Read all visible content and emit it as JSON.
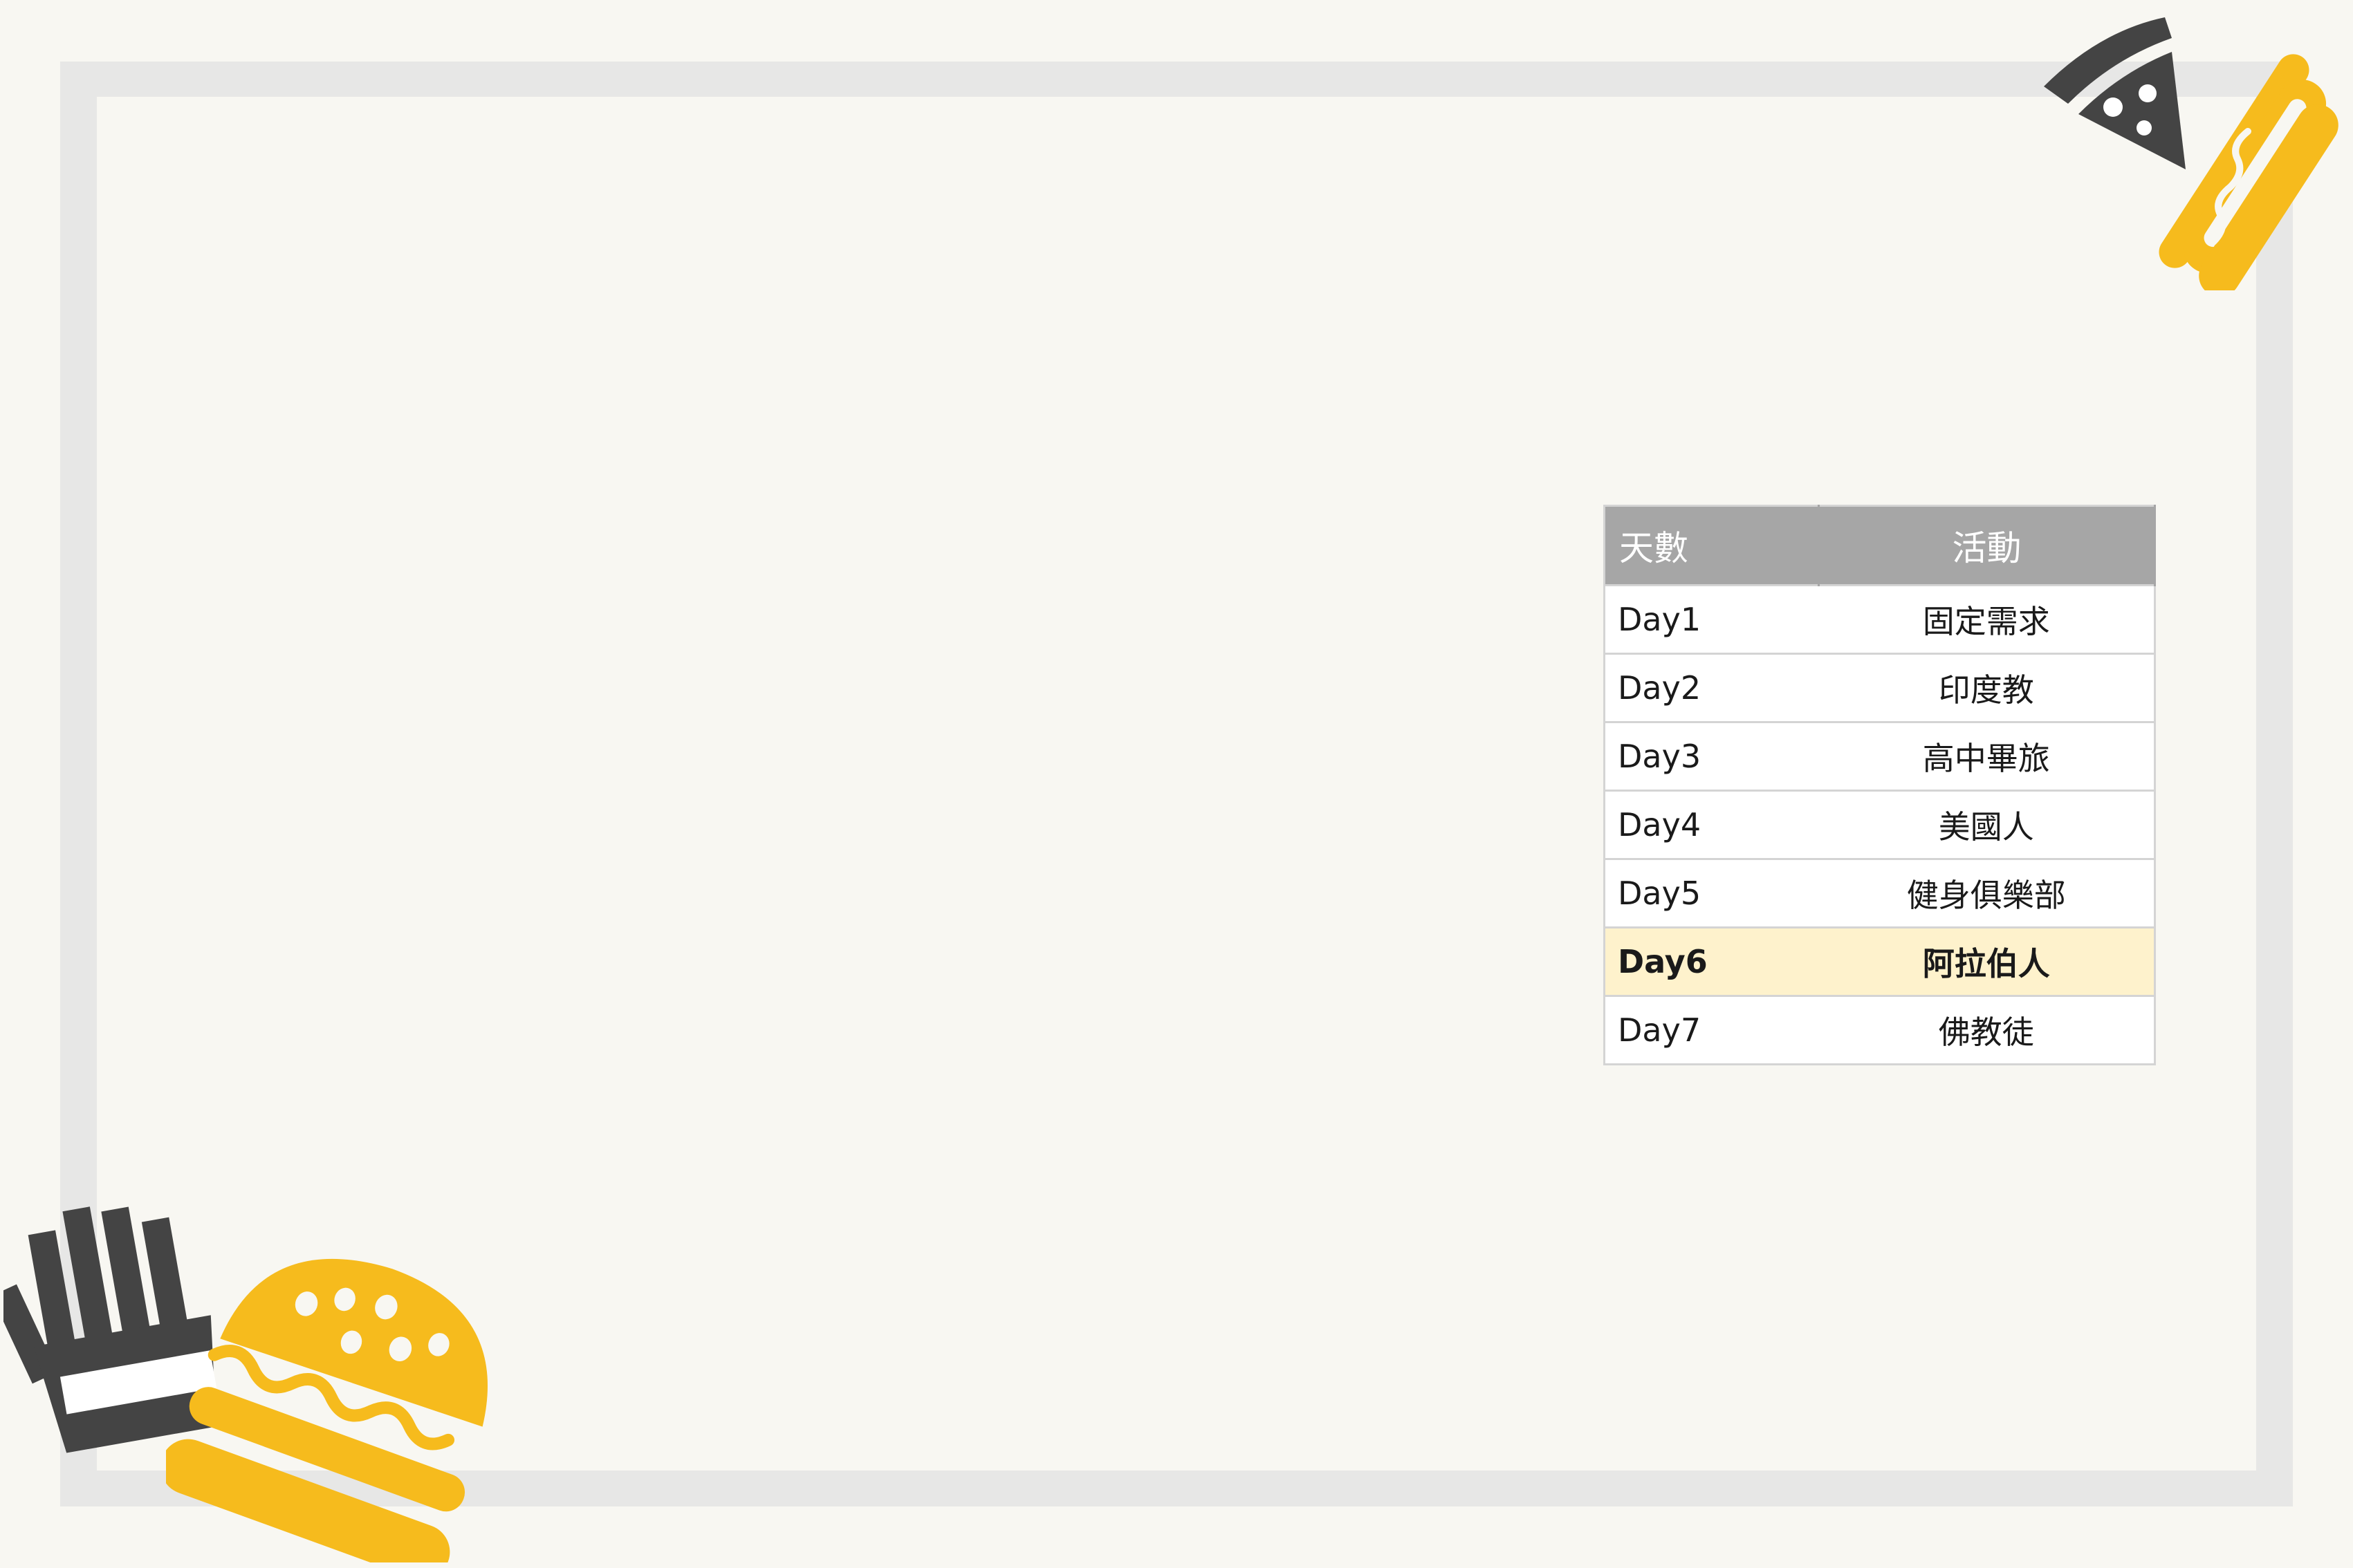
{
  "colors": {
    "background": "#f8f7f2",
    "frame": "#e7e7e6",
    "accent_yellow": "#f6bb1d",
    "icon_dark": "#444444",
    "table_header": "#a6a6a6",
    "highlight_row": "#fef2cc"
  },
  "icons": [
    "pizza-slice-icon",
    "hot-dog-icon",
    "french-fries-icon",
    "hamburger-icon"
  ],
  "table": {
    "headers": {
      "day": "天數",
      "activity": "活動"
    },
    "rows": [
      {
        "day": "Day1",
        "activity": "固定需求"
      },
      {
        "day": "Day2",
        "activity": "印度教"
      },
      {
        "day": "Day3",
        "activity": "高中畢旅"
      },
      {
        "day": "Day4",
        "activity": "美國人"
      },
      {
        "day": "Day5",
        "activity": "健身俱樂部"
      },
      {
        "day": "Day6",
        "activity": "阿拉伯人",
        "highlighted": true
      },
      {
        "day": "Day7",
        "activity": "佛教徒"
      }
    ]
  }
}
